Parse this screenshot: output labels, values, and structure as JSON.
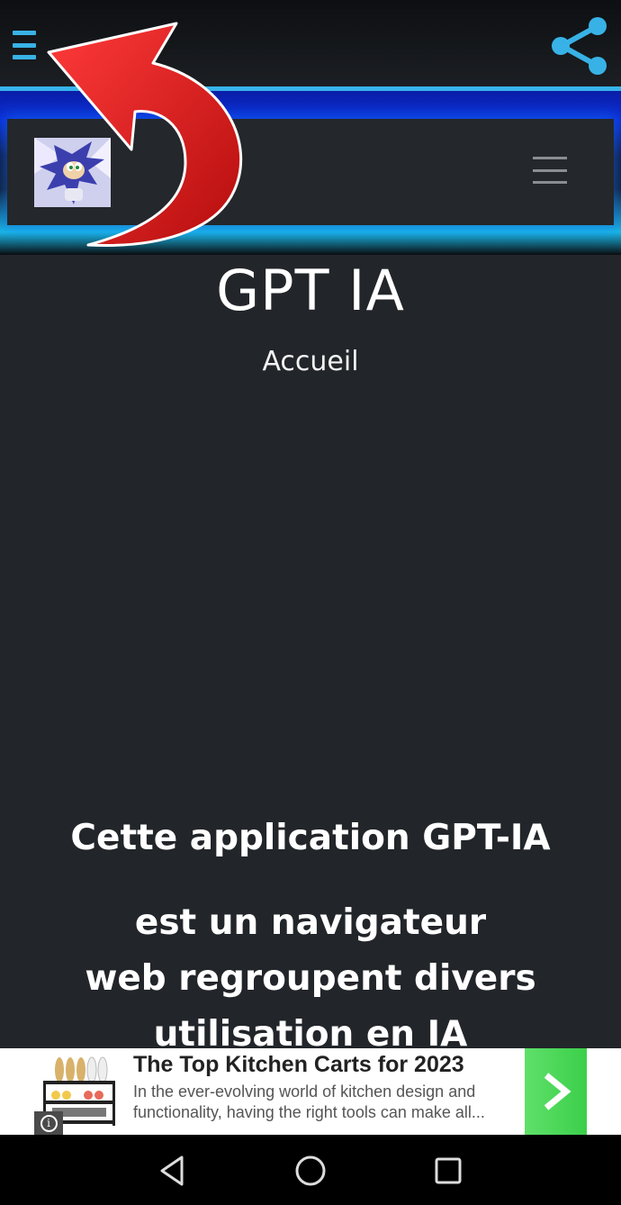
{
  "app_bar": {
    "drawer_icon": "hamburger-menu-icon",
    "share_icon": "share-icon",
    "accent_color": "#37b4ec"
  },
  "site_header": {
    "logo": "sonic-avatar-image",
    "menu_icon": "hamburger-menu-icon"
  },
  "page": {
    "title": "GPT IA",
    "subtitle": "Accueil",
    "lines": [
      "Cette application GPT-IA",
      "est un navigateur",
      "web regroupent divers",
      "utilisation en IA"
    ]
  },
  "overlay": {
    "arrow_icon": "curved-red-arrow",
    "arrow_color": "#e21b1b"
  },
  "ad": {
    "headline": "The Top Kitchen Carts for 2023",
    "body": "In the ever-evolving world of kitchen design and functionality, having the right tools can make all...",
    "info_icon": "info-icon",
    "go_icon": "chevron-right-icon",
    "go_color": "#45d452"
  },
  "nav_bar": {
    "back_icon": "back-triangle-icon",
    "home_icon": "home-circle-icon",
    "recents_icon": "recents-square-icon"
  }
}
